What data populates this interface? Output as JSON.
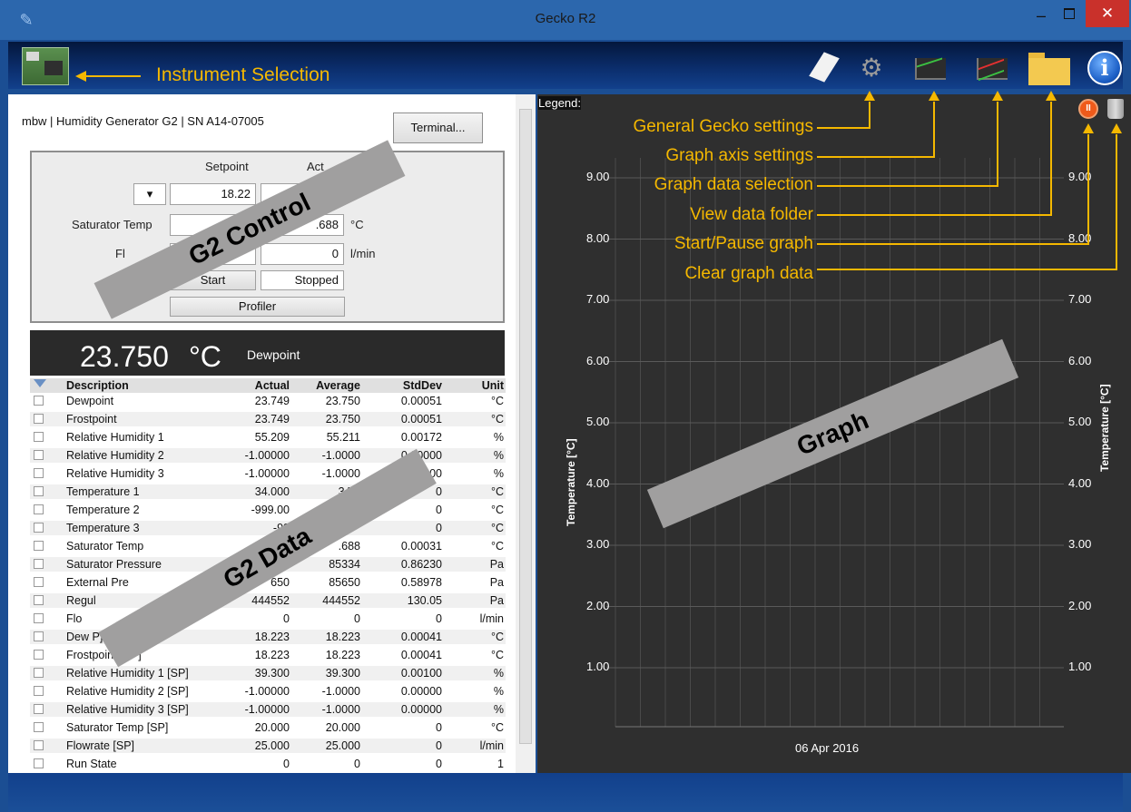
{
  "window": {
    "title": "Gecko R2",
    "minimize": "–",
    "close": "✕"
  },
  "toolbar": {
    "instrument_selection_label": "Instrument Selection"
  },
  "instrument": {
    "title": "mbw | Humidity Generator G2 | SN A14-07005",
    "terminal_button": "Terminal..."
  },
  "control": {
    "setpoint_header": "Setpoint",
    "actual_header": "Act",
    "dropdown_value": "",
    "setpoint_value": "18.22",
    "saturator_label": "Saturator Temp",
    "saturator_actual": ".688",
    "saturator_unit": "°C",
    "flow_label": "Fl",
    "flow_actual": "0",
    "flow_unit": "l/min",
    "start_button": "Start",
    "status": "Stopped",
    "profiler_button": "Profiler"
  },
  "dewpoint_display": {
    "value": "23.750",
    "unit": "°C",
    "label": "Dewpoint"
  },
  "table": {
    "headers": {
      "description": "Description",
      "actual": "Actual",
      "average": "Average",
      "stddev": "StdDev",
      "unit": "Unit"
    },
    "rows": [
      {
        "description": "Dewpoint",
        "actual": "23.749",
        "average": "23.750",
        "stddev": "0.00051",
        "unit": "°C"
      },
      {
        "description": "Frostpoint",
        "actual": "23.749",
        "average": "23.750",
        "stddev": "0.00051",
        "unit": "°C"
      },
      {
        "description": "Relative Humidity 1",
        "actual": "55.209",
        "average": "55.211",
        "stddev": "0.00172",
        "unit": "%"
      },
      {
        "description": "Relative Humidity 2",
        "actual": "-1.00000",
        "average": "-1.0000",
        "stddev": "0.00000",
        "unit": "%"
      },
      {
        "description": "Relative Humidity 3",
        "actual": "-1.00000",
        "average": "-1.0000",
        "stddev": "000",
        "unit": "%"
      },
      {
        "description": "Temperature 1",
        "actual": "34.000",
        "average": "34.0",
        "stddev": "0",
        "unit": "°C"
      },
      {
        "description": "Temperature 2",
        "actual": "-999.00",
        "average": "",
        "stddev": "0",
        "unit": "°C"
      },
      {
        "description": "Temperature 3",
        "actual": "-99",
        "average": "",
        "stddev": "0",
        "unit": "°C"
      },
      {
        "description": "Saturator Temp",
        "actual": "",
        "average": ".688",
        "stddev": "0.00031",
        "unit": "°C"
      },
      {
        "description": "Saturator Pressure",
        "actual": "",
        "average": "85334",
        "stddev": "0.86230",
        "unit": "Pa"
      },
      {
        "description": "External Pre",
        "actual": "650",
        "average": "85650",
        "stddev": "0.58978",
        "unit": "Pa"
      },
      {
        "description": "Regul",
        "actual": "444552",
        "average": "444552",
        "stddev": "130.05",
        "unit": "Pa"
      },
      {
        "description": "Flo",
        "actual": "0",
        "average": "0",
        "stddev": "0",
        "unit": "l/min"
      },
      {
        "description": "Dew P]",
        "actual": "18.223",
        "average": "18.223",
        "stddev": "0.00041",
        "unit": "°C"
      },
      {
        "description": "Frostpoint [SP]",
        "actual": "18.223",
        "average": "18.223",
        "stddev": "0.00041",
        "unit": "°C"
      },
      {
        "description": "Relative Humidity 1 [SP]",
        "actual": "39.300",
        "average": "39.300",
        "stddev": "0.00100",
        "unit": "%"
      },
      {
        "description": "Relative Humidity 2 [SP]",
        "actual": "-1.00000",
        "average": "-1.0000",
        "stddev": "0.00000",
        "unit": "%"
      },
      {
        "description": "Relative Humidity 3 [SP]",
        "actual": "-1.00000",
        "average": "-1.0000",
        "stddev": "0.00000",
        "unit": "%"
      },
      {
        "description": "Saturator Temp [SP]",
        "actual": "20.000",
        "average": "20.000",
        "stddev": "0",
        "unit": "°C"
      },
      {
        "description": "Flowrate [SP]",
        "actual": "25.000",
        "average": "25.000",
        "stddev": "0",
        "unit": "l/min"
      },
      {
        "description": "Run State",
        "actual": "0",
        "average": "0",
        "stddev": "0",
        "unit": "1"
      }
    ]
  },
  "graph": {
    "legend_label": "Legend:",
    "y_ticks": [
      "9.00",
      "8.00",
      "7.00",
      "6.00",
      "5.00",
      "4.00",
      "3.00",
      "2.00",
      "1.00"
    ],
    "y_label": "Temperature [°C]",
    "date_label": "06 Apr 2016"
  },
  "annotations": {
    "general_settings": "General Gecko settings",
    "axis_settings": "Graph axis settings",
    "data_selection": "Graph data selection",
    "data_folder": "View data folder",
    "start_pause": "Start/Pause graph",
    "clear": "Clear graph data"
  },
  "overlays": {
    "control": "G2 Control",
    "data": "G2 Data",
    "graph": "Graph"
  },
  "colors": {
    "annotation": "#f5b800",
    "titlebar": "#2c67ad",
    "close": "#c9312b",
    "graph_bg": "#2f2f2f",
    "overlay": "#a09f9f"
  },
  "icons": [
    "app-icon",
    "instrument-icon",
    "paper-icon",
    "settings-icon",
    "axis-icon",
    "data-selection-icon",
    "folder-icon",
    "info-icon",
    "pause-icon",
    "trash-icon",
    "filter-icon"
  ]
}
